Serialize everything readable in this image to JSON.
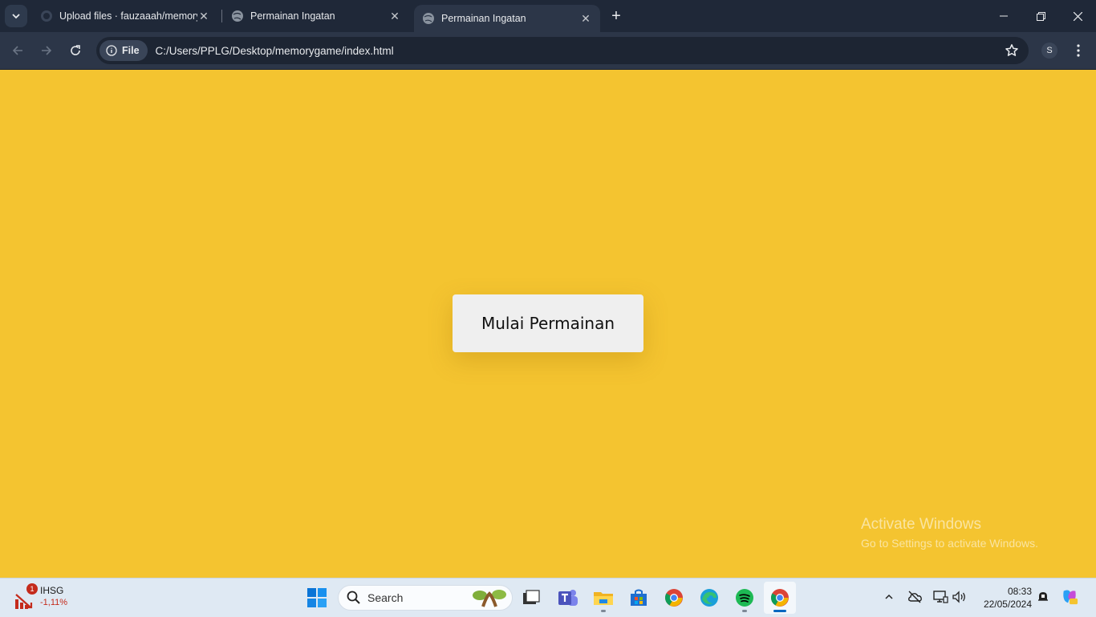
{
  "browser": {
    "tabs": [
      {
        "title": "Upload files · fauzaaah/memory",
        "icon": "github-icon"
      },
      {
        "title": "Permainan Ingatan",
        "icon": "globe-icon"
      },
      {
        "title": "Permainan Ingatan",
        "icon": "globe-icon",
        "active": true
      }
    ],
    "new_tab": "+",
    "address": {
      "chip_label": "File",
      "url": "C:/Users/PPLG/Desktop/memorygame/index.html"
    },
    "profile_initial": "S"
  },
  "page": {
    "start_button_label": "Mulai Permainan",
    "background_color": "#f4c430"
  },
  "watermark": {
    "title": "Activate Windows",
    "subtitle": "Go to Settings to activate Windows."
  },
  "taskbar": {
    "widget": {
      "badge": "1",
      "name": "IHSG",
      "change": "-1,11%"
    },
    "search_label": "Search",
    "apps": [
      "start-icon",
      "file-explorer-icon",
      "teams-icon",
      "files-icon",
      "store-icon",
      "chrome-icon",
      "edge-icon",
      "spotify-icon",
      "chrome-active-icon"
    ],
    "clock": {
      "time": "08:33",
      "date": "22/05/2024"
    }
  }
}
